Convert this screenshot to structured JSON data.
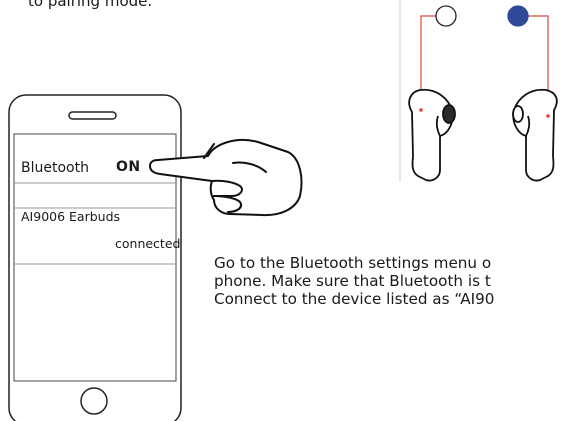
{
  "top_text": "to pairing mode.",
  "phone": {
    "bluetooth_label": "Bluetooth",
    "bluetooth_state": "ON",
    "device_name": "AI9006 Earbuds",
    "device_status": "connected"
  },
  "earbuds": {
    "led_left_color": "#ffffff",
    "led_right_color": "#2e4a99",
    "lead_line_color": "#e0453c"
  },
  "instructions": [
    "Go to the Bluetooth settings menu o",
    "phone. Make sure that Bluetooth is t",
    "Connect to the device listed as “AI90"
  ]
}
